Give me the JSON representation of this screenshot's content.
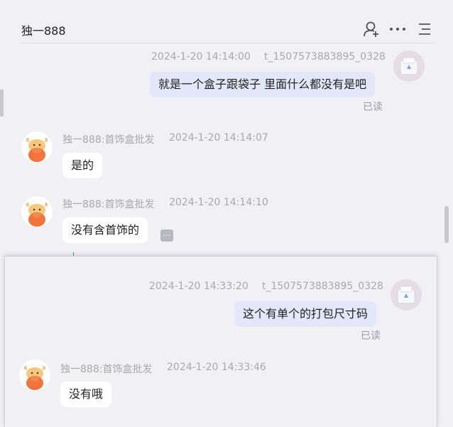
{
  "header": {
    "title": "独一888",
    "icons": [
      "add-contact-icon",
      "more-icon",
      "menu-icon"
    ]
  },
  "messages": [
    {
      "direction": "out",
      "time": "2024-1-20 14:14:00",
      "sender": "t_1507573883895_0328",
      "text": "就是一个盒子跟袋子 里面什么都没有是吧",
      "status": "已读"
    },
    {
      "direction": "in",
      "sender": "独一888:首饰盒批发",
      "time": "2024-1-20 14:14:07",
      "text": "是的"
    },
    {
      "direction": "in",
      "sender": "独一888:首饰盒批发",
      "time": "2024-1-20 14:14:10",
      "text": "没有含首饰的",
      "more_icon": "ellipsis-icon"
    }
  ],
  "popup_messages": [
    {
      "direction": "out",
      "time": "2024-1-20 14:33:20",
      "sender": "t_1507573883895_0328",
      "text": "这个有单个的打包尺寸码",
      "status": "已读"
    },
    {
      "direction": "in",
      "sender": "独一888:首饰盒批发",
      "time": "2024-1-20 14:33:46",
      "text": "没有哦"
    }
  ],
  "colors": {
    "background": "#f0f0f5",
    "bubble_out": "#e2e8fa",
    "bubble_in": "#ffffff",
    "meta_text": "#a8a8ad"
  }
}
